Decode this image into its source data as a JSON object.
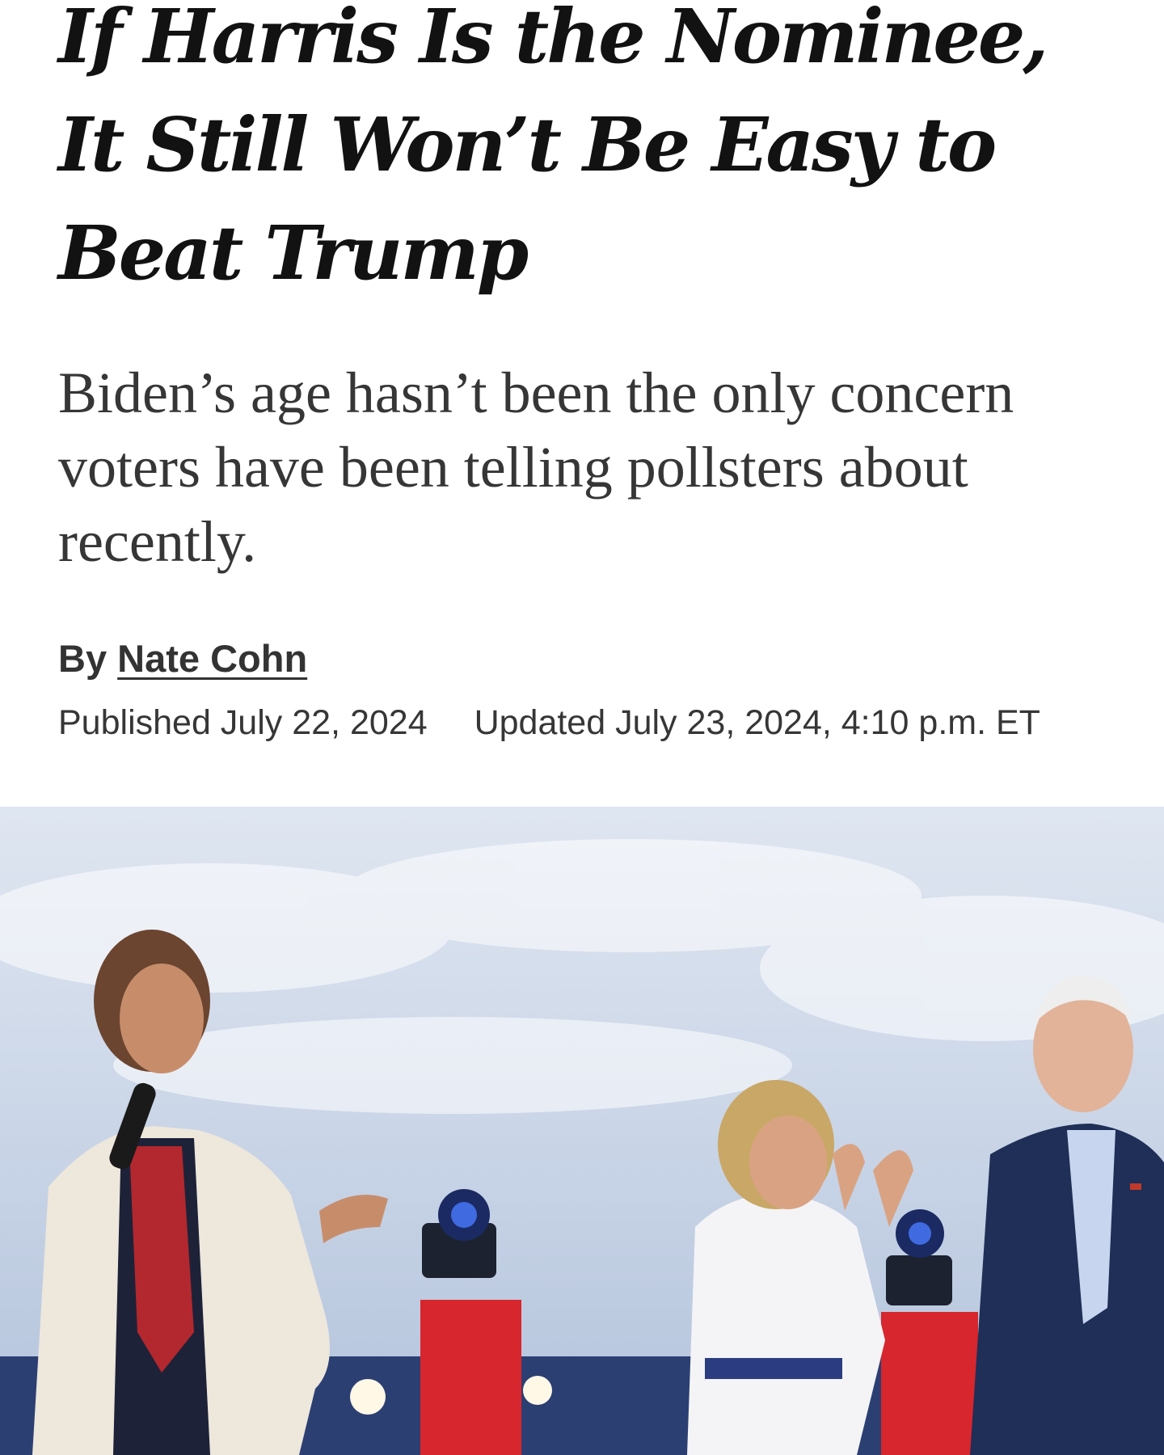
{
  "article": {
    "headline": "If Harris Is the Nominee, It Still Won’t Be Easy to Beat Trump",
    "summary": "Biden’s age hasn’t been the only concern voters have been telling pollsters about recently.",
    "byline": {
      "prefix": "By",
      "author": "Nate Cohn"
    },
    "published": "Published July 22, 2024",
    "updated": "Updated July 23, 2024, 4:10 p.m. ET"
  }
}
